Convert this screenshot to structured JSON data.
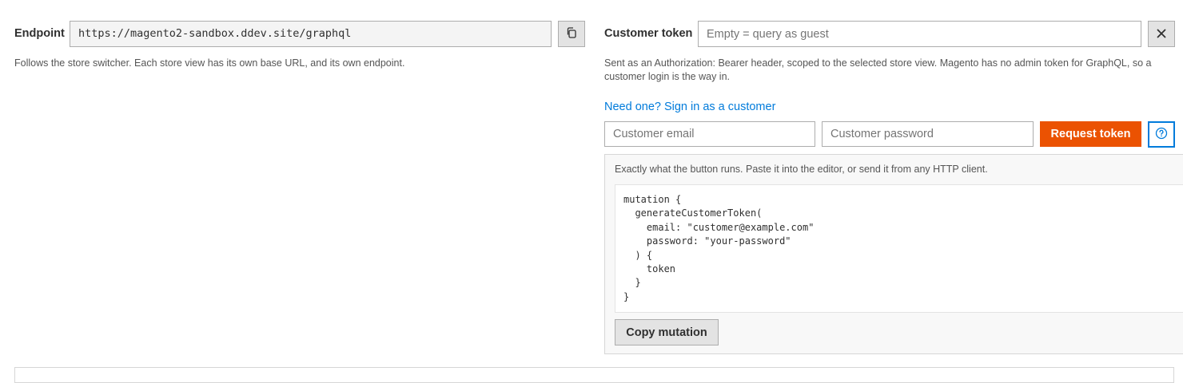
{
  "endpoint": {
    "label": "Endpoint",
    "value": "https://magento2-sandbox.ddev.site/graphql",
    "note": "Follows the store switcher. Each store view has its own base URL, and its own endpoint."
  },
  "token": {
    "label": "Customer token",
    "placeholder": "Empty = query as guest",
    "note": "Sent as an Authorization: Bearer header, scoped to the selected store view. Magento has no admin token for GraphQL, so a customer login is the way in."
  },
  "signin": {
    "link_label": "Need one? Sign in as a customer",
    "email_placeholder": "Customer email",
    "password_placeholder": "Customer password",
    "request_label": "Request token"
  },
  "panel": {
    "description": "Exactly what the button runs. Paste it into the editor, or send it from any HTTP client.",
    "mutation": "mutation {\n  generateCustomerToken(\n    email: \"customer@example.com\"\n    password: \"your-password\"\n  ) {\n    token\n  }\n}",
    "copy_label": "Copy mutation"
  },
  "icons": {
    "copy": "copy-icon",
    "clear": "close-icon",
    "help": "help-icon"
  },
  "colors": {
    "accent": "#eb5202",
    "link": "#007bdb"
  }
}
